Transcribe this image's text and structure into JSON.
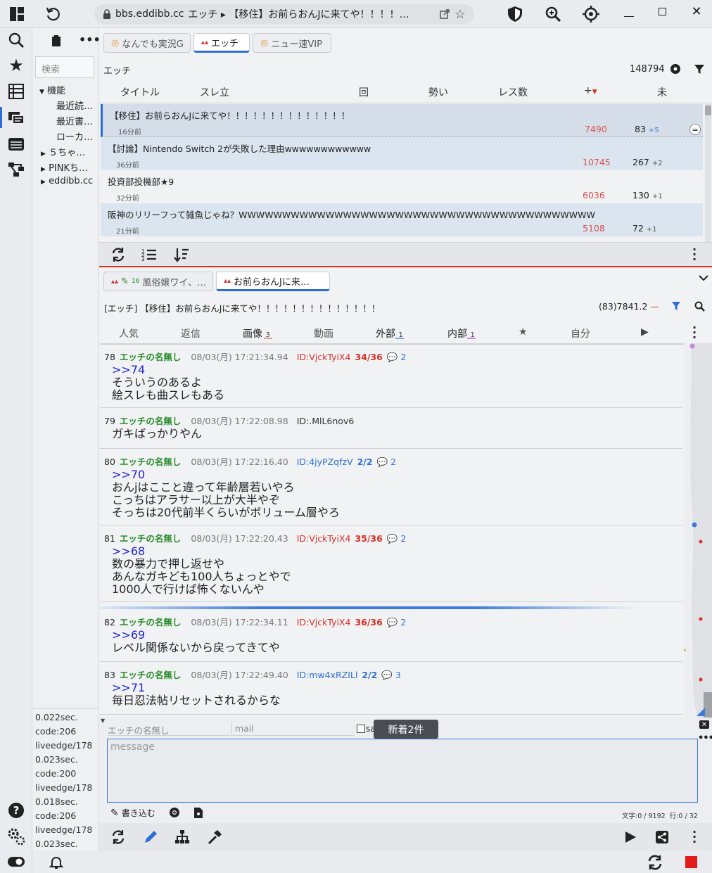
{
  "browser": {
    "url": "bbs.eddibb.cc",
    "page_title": "エッチ ▸ 【移住】お前らおんJに来てや！！！！…"
  },
  "sidebar": {
    "search_placeholder": "検索",
    "tree": [
      {
        "label": "機能",
        "children": [
          "最近読…",
          "最近書…",
          "ローカ…"
        ]
      },
      {
        "label": "５ちゃ…"
      },
      {
        "label": "PINKち…"
      },
      {
        "label": "eddibb.cc"
      }
    ],
    "log": [
      "0.022sec.",
      "code:206",
      "liveedge/178",
      "0.023sec.",
      "code:200",
      "liveedge/178",
      "0.018sec.",
      "code:206",
      "liveedge/178",
      "0.023sec."
    ]
  },
  "board": {
    "tabs": [
      "なんでも実況G",
      "エッチ",
      "ニュー速VIP"
    ],
    "name": "エッチ",
    "count": "148794",
    "columns": [
      "タイトル",
      "スレ立",
      "回",
      "勢い",
      "レス数",
      "+",
      "未"
    ],
    "threads": [
      {
        "title": "【移住】お前らおんJに来てや！！！！！！！！！！！！！！",
        "ago": "16分前",
        "ikioi": "7490",
        "res": "83",
        "delta": "+5"
      },
      {
        "title": "【討論】Nintendo Switch 2が失敗した理由wwwwwwwwwwww",
        "ago": "36分前",
        "ikioi": "10745",
        "res": "267",
        "delta": "+2"
      },
      {
        "title": "投資部投機部★9",
        "ago": "32分前",
        "ikioi": "6036",
        "res": "130",
        "delta": "+1"
      },
      {
        "title": "阪神のリリーフって雑魚じゃね？WWWWWWWWWWWWWWWWWWWWWWWWWWWWWWWWWWWWWWWWW",
        "ago": "21分前",
        "ikioi": "5108",
        "res": "72",
        "delta": "+1"
      }
    ]
  },
  "thread_tabs": [
    {
      "label": "風俗嬢ワイ、…",
      "badge": "16"
    },
    {
      "label": "お前らおんJに来…"
    }
  ],
  "thread": {
    "header": "[エッチ]  【移住】お前らおんJに来てや！！！！！！！！！！！！！！",
    "stats": "(83)7841.2",
    "stats_arrow": "—",
    "filters": [
      {
        "label": "人気",
        "n": ""
      },
      {
        "label": "返信",
        "n": ""
      },
      {
        "label": "画像",
        "n": "3"
      },
      {
        "label": "動画",
        "n": ""
      },
      {
        "label": "外部",
        "n": "1"
      },
      {
        "label": "内部",
        "n": "1"
      },
      {
        "label": "★",
        "n": ""
      },
      {
        "label": "自分",
        "n": ""
      }
    ],
    "posts": [
      {
        "no": "78",
        "name": "エッチの名無し",
        "date": "08/03(月) 17:21:34.94",
        "id": "ID:VjckTyiX4",
        "cnt": "34/36",
        "rep": "2",
        "anchor": ">>74",
        "body": "そういうのあるよ\n絵スレも曲スレもある"
      },
      {
        "no": "79",
        "name": "エッチの名無し",
        "date": "08/03(月) 17:22:08.98",
        "id": "ID:.MlL6nov6",
        "cnt": "",
        "rep": "",
        "anchor": "",
        "body": "ガキばっかりやん"
      },
      {
        "no": "80",
        "name": "エッチの名無し",
        "date": "08/03(月) 17:22:16.40",
        "id": "ID:4jyPZqfzV",
        "cnt": "2/2",
        "rep": "2",
        "anchor": ">>70",
        "body": "おんjはここと違って年齢層若いやろ\nこっちはアラサー以上が大半やぞ\nそっちは20代前半くらいがボリューム層やろ"
      },
      {
        "no": "81",
        "name": "エッチの名無し",
        "date": "08/03(月) 17:22:20.43",
        "id": "ID:VjckTyiX4",
        "cnt": "35/36",
        "rep": "2",
        "anchor": ">>68",
        "body": "数の暴力で押し返せや\nあんなガキども100人ちょっとやで\n1000人で行けば怖くないんや"
      },
      {
        "no": "82",
        "name": "エッチの名無し",
        "date": "08/03(月) 17:22:34.11",
        "id": "ID:VjckTyiX4",
        "cnt": "36/36",
        "rep": "2",
        "anchor": ">>69",
        "body": "レベル関係ないから戻ってきてや"
      },
      {
        "no": "83",
        "name": "エッチの名無し",
        "date": "08/03(月) 17:22:49.40",
        "id": "ID:mw4xRZILl",
        "cnt": "2/2",
        "rep": "3",
        "anchor": ">>71",
        "body": "毎日忍法帖リセットされるからな"
      }
    ]
  },
  "compose": {
    "name_placeholder": "エッチの名無し",
    "mail_placeholder": "mail",
    "sage_label": "sage",
    "message_placeholder": "message",
    "new_toast": "新着2件",
    "write_label": "書き込む",
    "char_count": "文字:0 / 9192",
    "line_count": "行:0 / 32"
  },
  "colors": {
    "accent": "#2d6fd6",
    "red": "#d93025",
    "name_green": "#2a8c2a",
    "id_red": "#d93025",
    "id_blue": "#2d6fd6"
  }
}
